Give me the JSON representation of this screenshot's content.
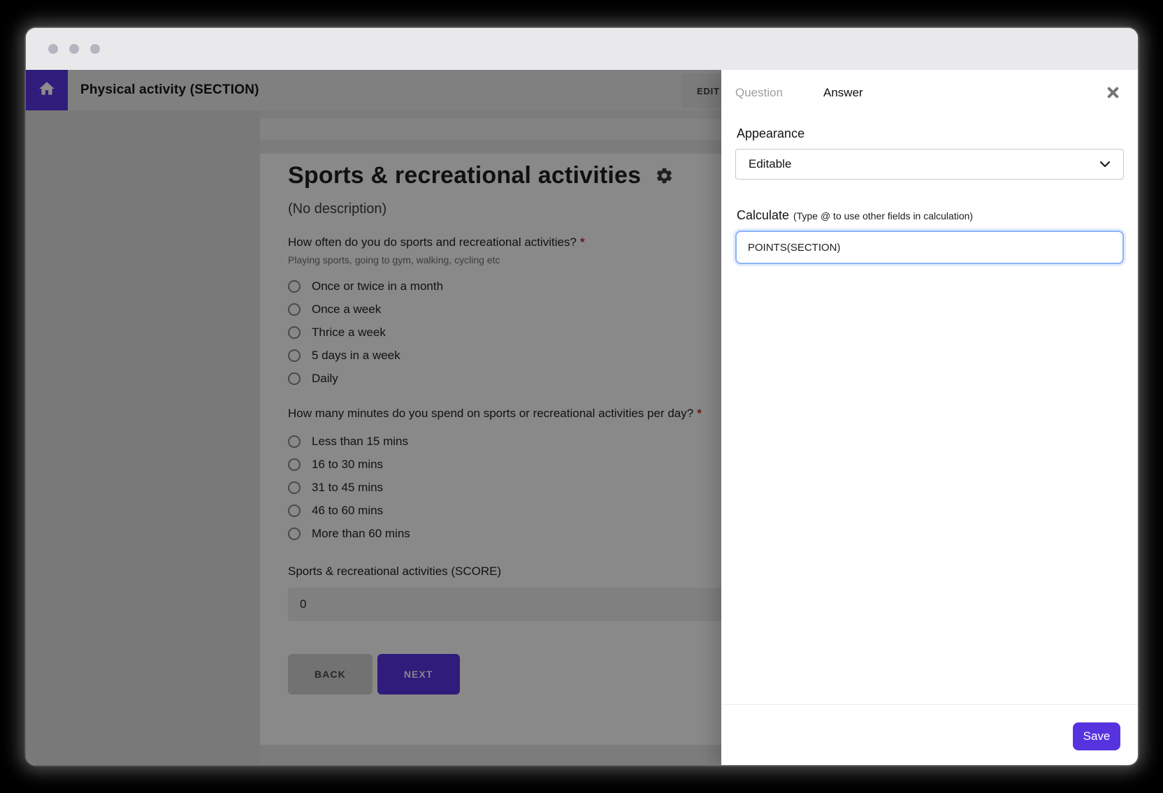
{
  "header": {
    "title": "Physical activity (SECTION)",
    "edit_label": "EDIT"
  },
  "form": {
    "title": "Sports & recreational activities",
    "description": "(No description)",
    "questions": [
      {
        "label": "How often do you do sports and recreational activities?",
        "required": "*",
        "hint": "Playing sports, going to gym, walking, cycling etc",
        "options": [
          "Once or twice in a month",
          "Once a week",
          "Thrice a week",
          "5 days in a week",
          "Daily"
        ]
      },
      {
        "label": "How many minutes do you spend on sports or recreational activities per day?",
        "required": "*",
        "hint": "",
        "options": [
          "Less than 15 mins",
          "16 to 30 mins",
          "31 to 45 mins",
          "46 to 60 mins",
          "More than 60 mins"
        ]
      }
    ],
    "score_field": {
      "label": "Sports & recreational activities (SCORE)",
      "value": "0"
    },
    "back_label": "BACK",
    "next_label": "NEXT"
  },
  "panel": {
    "tab_question": "Question",
    "tab_answer": "Answer",
    "appearance": {
      "label": "Appearance",
      "value": "Editable"
    },
    "calculate": {
      "label": "Calculate",
      "hint": "(Type @ to use other fields in calculation)",
      "value": "POINTS(SECTION)"
    },
    "save_label": "Save"
  },
  "colors": {
    "accent": "#5733e0",
    "focus_border": "#8ab4f8",
    "required": "#c62828"
  }
}
